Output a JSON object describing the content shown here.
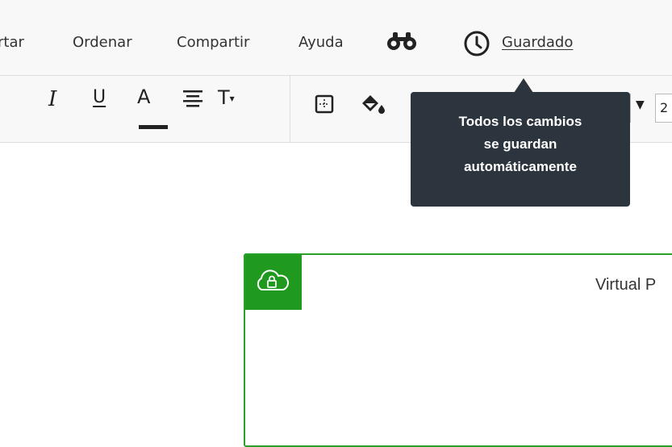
{
  "menu": {
    "items": [
      "rtar",
      "Ordenar",
      "Compartir",
      "Ayuda"
    ],
    "saved_label": "Guardado"
  },
  "toolbar": {
    "italic_glyph": "I",
    "underline_glyph": "U",
    "font_color_glyph": "A",
    "text_size_glyph": "T",
    "font_size_partial": "2"
  },
  "tooltip": {
    "lines": [
      "Todos los cambios",
      "se guardan",
      "automáticamente"
    ]
  },
  "canvas": {
    "label": "Virtual P",
    "accent_color": "#1f9a1f"
  },
  "icons": {
    "find": "binoculars-icon",
    "history": "clock-icon",
    "align": "align-center-icon",
    "border": "border-icon",
    "fill": "fill-color-icon",
    "cloud": "cloud-lock-icon"
  }
}
